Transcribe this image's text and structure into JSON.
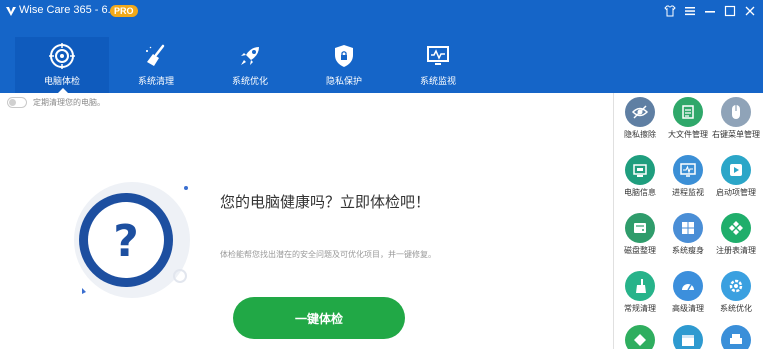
{
  "app": {
    "title": "Wise Care 365 - 6.1.1",
    "badge": "PRO"
  },
  "window_controls": [
    "shirt-icon",
    "menu-icon",
    "minimize-icon",
    "maximize-icon",
    "close-icon"
  ],
  "tabs": [
    {
      "label": "电脑体检",
      "icon": "scan-target-icon",
      "active": true
    },
    {
      "label": "系统清理",
      "icon": "broom-icon",
      "active": false
    },
    {
      "label": "系统优化",
      "icon": "rocket-icon",
      "active": false
    },
    {
      "label": "隐私保护",
      "icon": "shield-lock-icon",
      "active": false
    },
    {
      "label": "系统监视",
      "icon": "monitor-pulse-icon",
      "active": false
    }
  ],
  "main": {
    "schedule_label": "定期清理您的电脑。",
    "headline": "您的电脑健康吗？立即体检吧！",
    "subline": "体检能帮您找出潜在的安全问题及可优化项目，并一键修复。",
    "scan_button": "一键体检"
  },
  "tools": [
    {
      "label": "隐私擦除",
      "icon": "eye-slash-icon",
      "color": "#5f7fa3"
    },
    {
      "label": "大文件管理",
      "icon": "file-grid-icon",
      "color": "#2fa86a"
    },
    {
      "label": "右键菜单管理",
      "icon": "mouse-icon",
      "color": "#8fa3b8"
    },
    {
      "label": "电脑信息",
      "icon": "chip-icon",
      "color": "#1f9e7e"
    },
    {
      "label": "进程监视",
      "icon": "process-monitor-icon",
      "color": "#3b8fd6"
    },
    {
      "label": "启动项管理",
      "icon": "play-icon",
      "color": "#2ba6c8"
    },
    {
      "label": "磁盘整理",
      "icon": "disk-icon",
      "color": "#2f9c6b"
    },
    {
      "label": "系统瘦身",
      "icon": "windows-icon",
      "color": "#4a8ed6"
    },
    {
      "label": "注册表清理",
      "icon": "registry-icon",
      "color": "#1fae6b"
    },
    {
      "label": "常规清理",
      "icon": "brush-icon",
      "color": "#27b38a"
    },
    {
      "label": "高级清理",
      "icon": "speed-icon",
      "color": "#3c8fdc"
    },
    {
      "label": "系统优化",
      "icon": "gear-icon",
      "color": "#3aa0e0"
    },
    {
      "label": "",
      "icon": "diamond-icon",
      "color": "#2fae5f"
    },
    {
      "label": "",
      "icon": "calendar-icon",
      "color": "#2e9ad0"
    },
    {
      "label": "",
      "icon": "printer-icon",
      "color": "#3a8fd9"
    }
  ]
}
